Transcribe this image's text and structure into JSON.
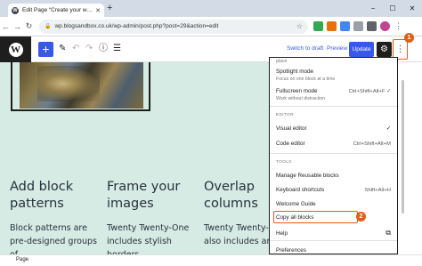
{
  "browser": {
    "tab_title": "Edit Page “Create your website",
    "tab_favicon": "W",
    "new_tab": "+",
    "url": "wp.blogsandbox.co.uk/wp-admin/post.php?post=29&action=edit",
    "window_controls": [
      "−",
      "☐",
      "✕"
    ]
  },
  "editor_toolbar": {
    "wp_logo": "W",
    "inserter": "+",
    "switch_to_draft": "Switch to draft",
    "preview": "Preview",
    "update": "Update",
    "settings_icon": "⚙",
    "options_icon": "⋮"
  },
  "canvas": {
    "columns": [
      {
        "heading": "Add block patterns",
        "text": "Block patterns are pre-designed groups of"
      },
      {
        "heading": "Frame your images",
        "text": "Twenty Twenty-One includes stylish borders"
      },
      {
        "heading": "Overlap columns",
        "text": "Twenty Twenty-One also includes an ov"
      }
    ]
  },
  "options_menu": {
    "partial_top": "place",
    "spotlight": {
      "label": "Spotlight mode",
      "desc": "Focus on one block at a time"
    },
    "fullscreen": {
      "label": "Fullscreen mode",
      "desc": "Work without distraction",
      "shortcut": "Ctrl+Shift+Alt+F"
    },
    "editor_group": "EDITOR",
    "visual_editor": "Visual editor",
    "code_editor": "Code editor",
    "code_shortcut": "Ctrl+Shift+Alt+M",
    "tools_group": "TOOLS",
    "reusable": "Manage Reusable blocks",
    "keyboard": "Keyboard shortcuts",
    "keyboard_shortcut": "Shift+Alt+H",
    "welcome": "Welcome Guide",
    "copy_all": "Copy all blocks",
    "help": "Help",
    "preferences": "Preferences",
    "checkmark": "✓"
  },
  "callouts": {
    "first": "1",
    "second": "2"
  },
  "footer": {
    "breadcrumb": "Page"
  },
  "colors": {
    "accent": "#3858e9",
    "callout": "#e25d16",
    "canvas_bg": "#d6ebe3"
  }
}
